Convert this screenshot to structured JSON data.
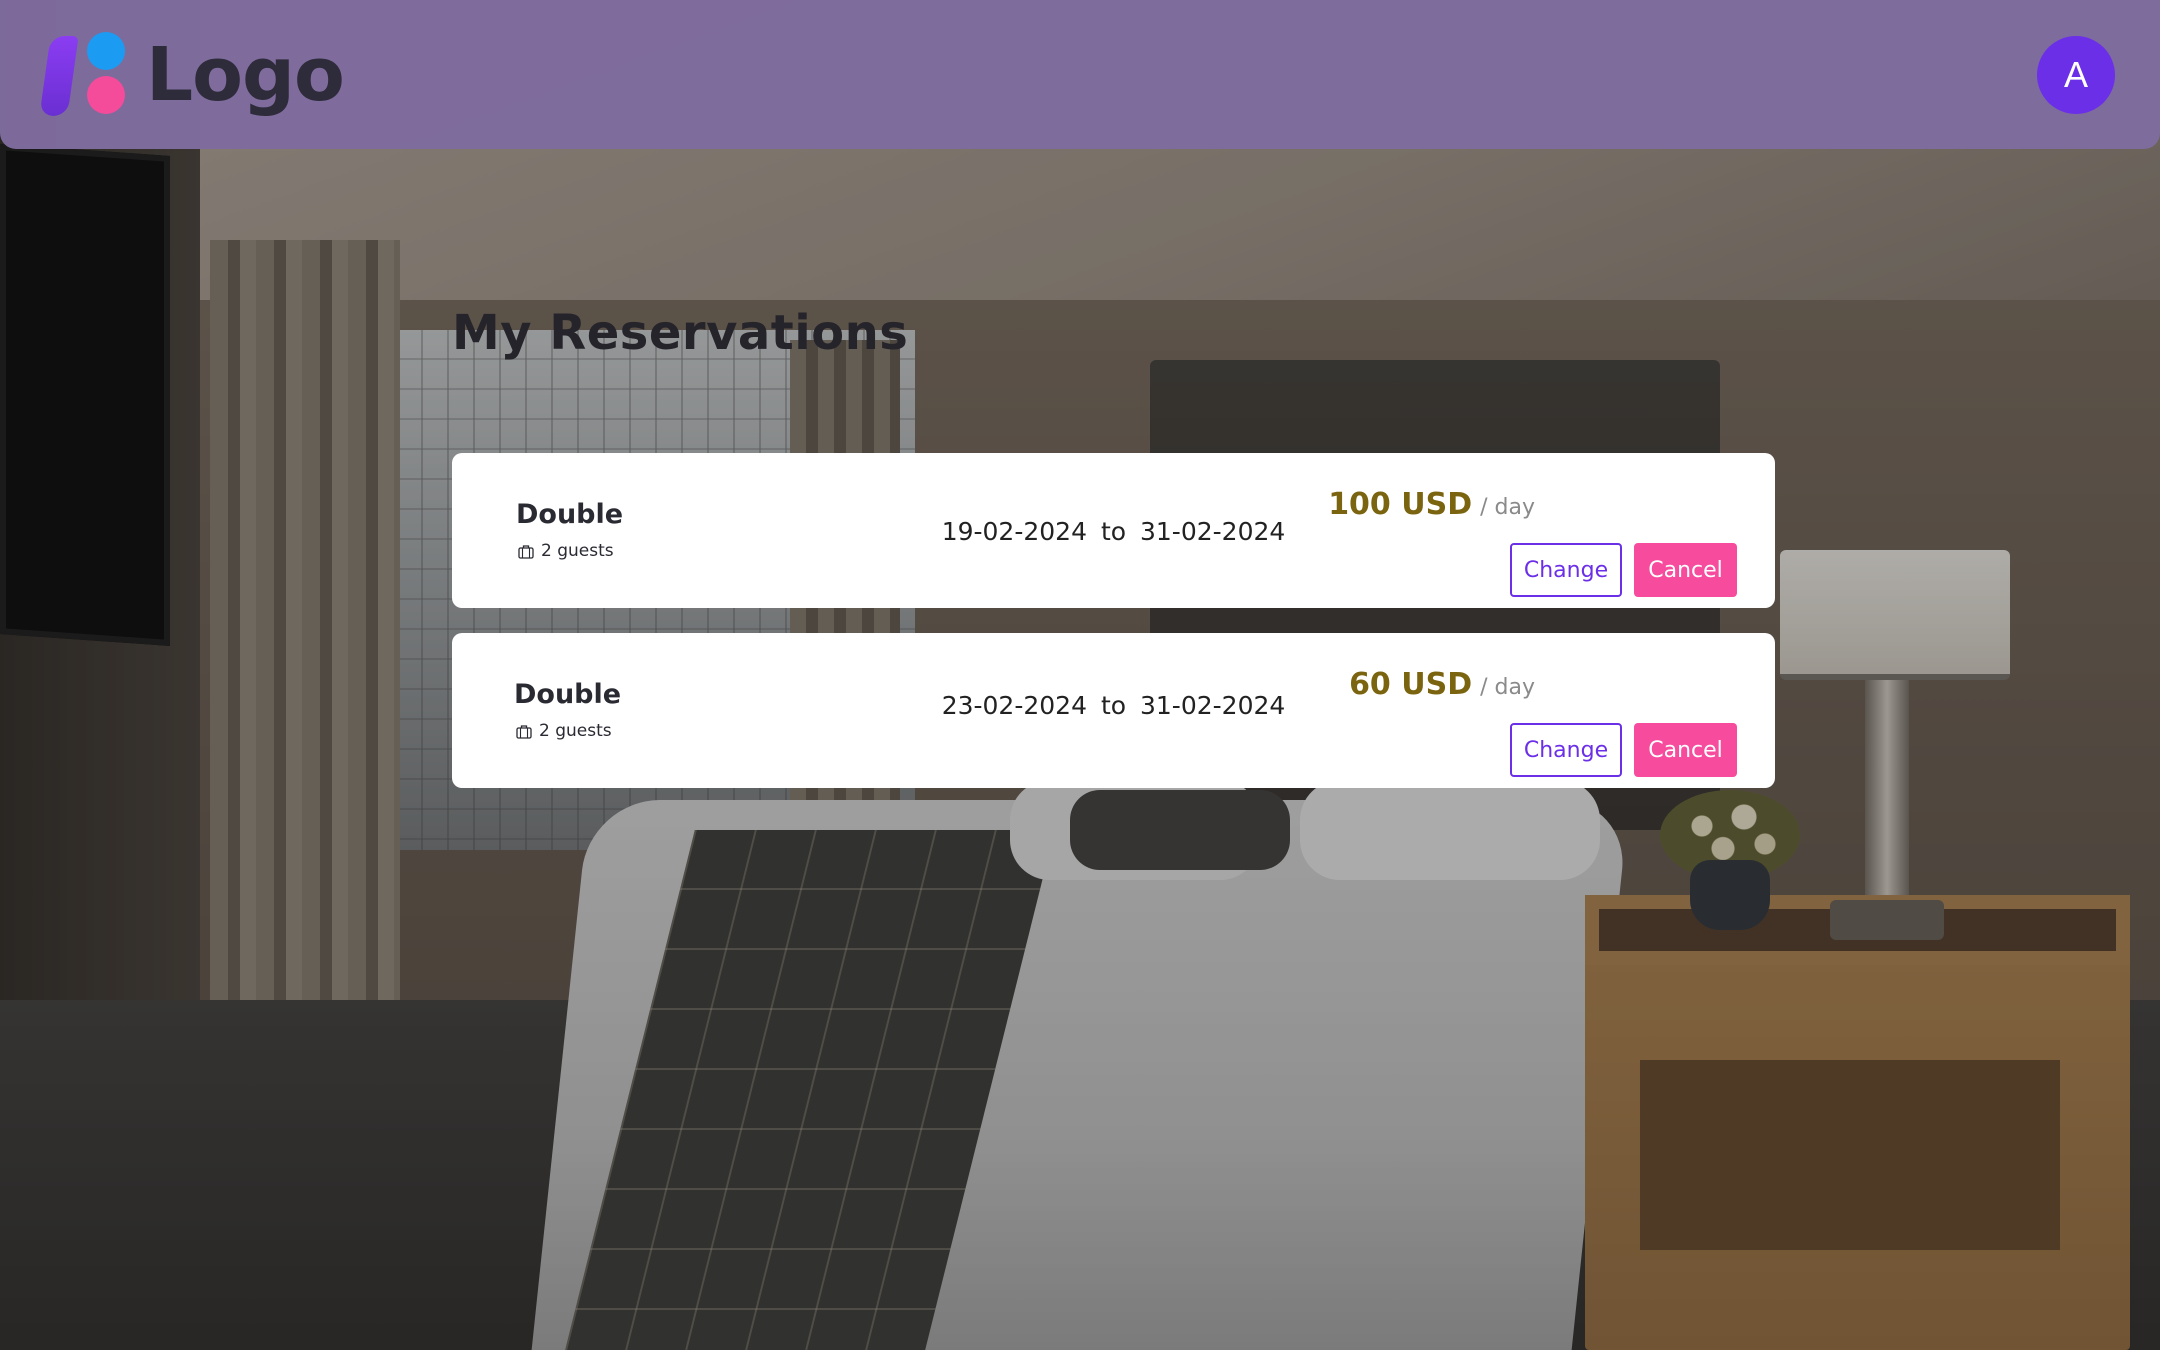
{
  "header": {
    "logo_text": "Logo",
    "avatar_initial": "A"
  },
  "page": {
    "title": "My Reservations"
  },
  "reservations": [
    {
      "room": "Double",
      "guests": "2 guests",
      "start_date": "19-02-2024",
      "to": "to",
      "end_date": "31-02-2024",
      "price": "100 USD",
      "price_unit": "/ day",
      "change_label": "Change",
      "cancel_label": "Cancel"
    },
    {
      "room": "Double",
      "guests": "2 guests",
      "start_date": "23-02-2024",
      "to": "to",
      "end_date": "31-02-2024",
      "price": "60 USD",
      "price_unit": "/ day",
      "change_label": "Change",
      "cancel_label": "Cancel"
    }
  ],
  "icons": {
    "guests": "luggage-icon"
  },
  "colors": {
    "header_bg": "#7e6c9e",
    "accent": "#6b2fe8",
    "cancel": "#f74c9e",
    "price": "#7b6410"
  }
}
